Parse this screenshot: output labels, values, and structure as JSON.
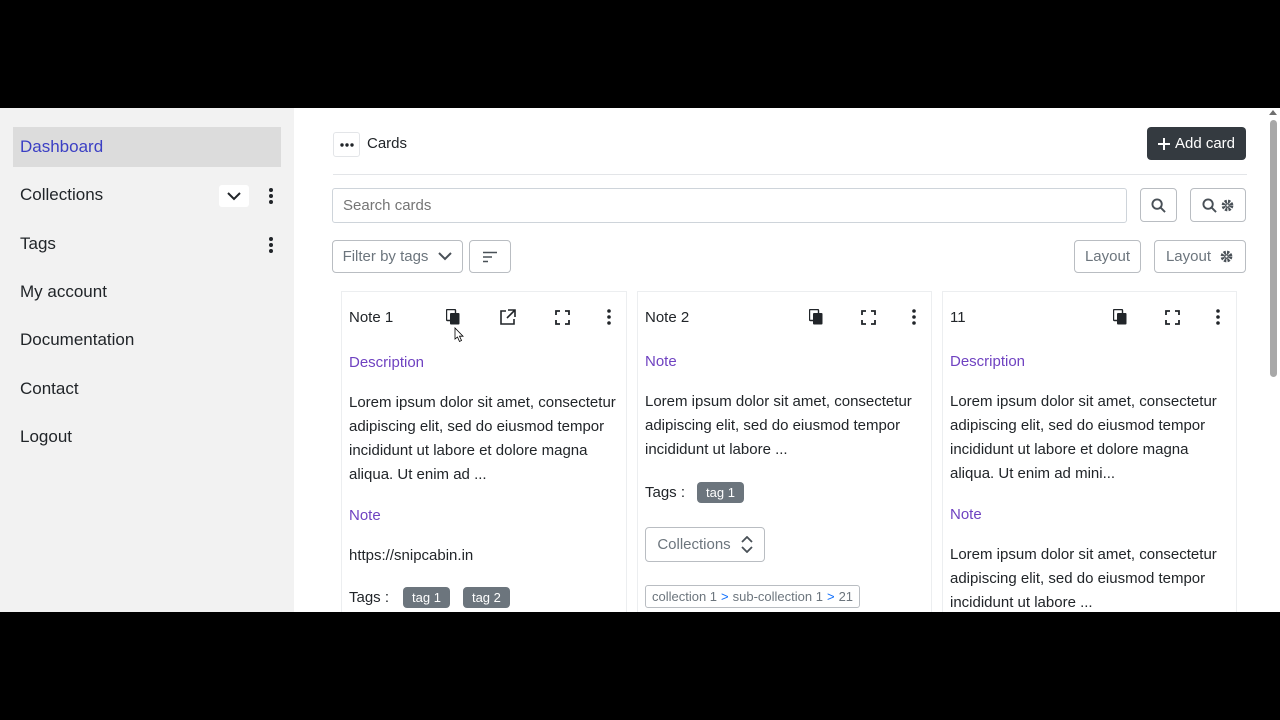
{
  "sidebar": {
    "items": [
      {
        "label": "Dashboard"
      },
      {
        "label": "Collections"
      },
      {
        "label": "Tags"
      },
      {
        "label": "My account"
      },
      {
        "label": "Documentation"
      },
      {
        "label": "Contact"
      },
      {
        "label": "Logout"
      }
    ]
  },
  "header": {
    "breadcrumb": "Cards",
    "add_card_label": "Add card"
  },
  "search": {
    "placeholder": "Search cards"
  },
  "filters": {
    "filter_by_tags": "Filter by tags",
    "layout_label": "Layout",
    "layout_settings_label": "Layout"
  },
  "cards": [
    {
      "title": "Note 1",
      "description_title": "Description",
      "description_text": "Lorem ipsum dolor sit amet, consectetur adipiscing elit, sed do eiusmod tempor incididunt ut labore et dolore magna aliqua. Ut enim ad ...",
      "note_title": "Note",
      "note_text": "https://snipcabin.in",
      "tags_label": "Tags :",
      "tags": [
        "tag 1",
        "tag 2"
      ]
    },
    {
      "title": "Note 2",
      "note_title": "Note",
      "note_text": "Lorem ipsum dolor sit amet, consectetur adipiscing elit, sed do eiusmod tempor incididunt ut labore ...",
      "tags_label": "Tags :",
      "tags": [
        "tag 1"
      ],
      "collections_label": "Collections",
      "collection_path": {
        "a": "collection 1",
        "sep1": ">",
        "b": "sub-collection 1",
        "sep2": ">",
        "c": "21"
      }
    },
    {
      "title": "11",
      "description_title": "Description",
      "description_text": "Lorem ipsum dolor sit amet, consectetur adipiscing elit, sed do eiusmod tempor incididunt ut labore et dolore magna aliqua. Ut enim ad mini...",
      "note_title": "Note",
      "note_text": "Lorem ipsum dolor sit amet, consectetur adipiscing elit, sed do eiusmod tempor incididunt ut labore ..."
    }
  ],
  "colors": {
    "accent": "#6f42c1",
    "active_nav": "#3b3fc4",
    "dark_button": "#343a40",
    "tag_bg": "#6c757d"
  }
}
